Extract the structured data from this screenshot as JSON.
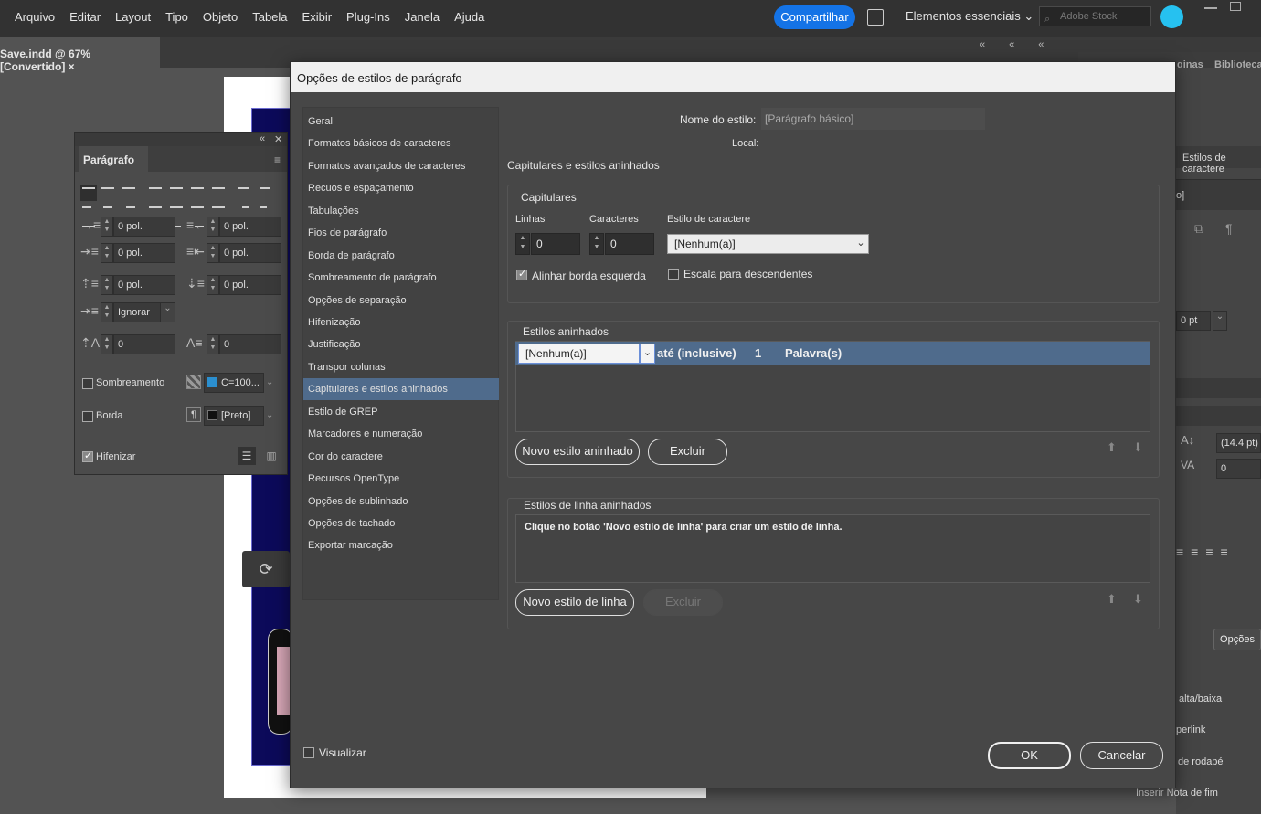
{
  "menubar": {
    "items": [
      "Arquivo",
      "Editar",
      "Layout",
      "Tipo",
      "Objeto",
      "Tabela",
      "Exibir",
      "Plug-Ins",
      "Janela",
      "Ajuda"
    ],
    "share": "Compartilhar",
    "workspace": "Elementos essenciais",
    "stock_placeholder": "Adobe Stock"
  },
  "document": {
    "tab_title": "Save.indd @ 67% [Convertido]",
    "close": "×"
  },
  "paragraph_panel": {
    "title": "Parágrafo",
    "indent_left": "0 pol.",
    "indent_right": "0 pol.",
    "first_line": "0 pol.",
    "last_line": "0 pol.",
    "space_before": "0 pol.",
    "space_after": "0 pol.",
    "grid_align": "Ignorar",
    "dropcap_lines": "0",
    "dropcap_chars": "0",
    "shading_label": "Sombreamento",
    "shading_value": "C=100...",
    "border_label": "Borda",
    "border_value": "[Preto]",
    "hyphenate_label": "Hifenizar",
    "shading_checked": false,
    "border_checked": false,
    "hyphenate_checked": true
  },
  "right_panel": {
    "tab1": "ginas",
    "tab2": "Biblioteca",
    "char_styles": "Estilos de caractere",
    "field1": "o]",
    "spacing": "0 pt",
    "leading": "(14.4 pt)",
    "tracking": "0",
    "options_btn": "Opções",
    "item1": "alta/baixa",
    "item2": "perlink",
    "item3": "de rodapé",
    "item4": "Inserir Nota de fim"
  },
  "dialog": {
    "title": "Opções de estilos de parágrafo",
    "categories": [
      "Geral",
      "Formatos básicos de caracteres",
      "Formatos avançados de caracteres",
      "Recuos e espaçamento",
      "Tabulações",
      "Fios de parágrafo",
      "Borda de parágrafo",
      "Sombreamento de parágrafo",
      "Opções de separação",
      "Hifenização",
      "Justificação",
      "Transpor colunas",
      "Capitulares e estilos aninhados",
      "Estilo de GREP",
      "Marcadores e numeração",
      "Cor do caractere",
      "Recursos OpenType",
      "Opções de sublinhado",
      "Opções de tachado",
      "Exportar marcação"
    ],
    "selected_category": "Capitulares e estilos aninhados",
    "style_name_label": "Nome do estilo:",
    "style_name_value": "[Parágrafo básico]",
    "location_label": "Local:",
    "section_title": "Capitulares e estilos aninhados",
    "dropcaps": {
      "legend": "Capitulares",
      "lines_label": "Linhas",
      "lines_value": "0",
      "chars_label": "Caracteres",
      "chars_value": "0",
      "char_style_label": "Estilo de caractere",
      "char_style_value": "[Nenhum(a)]",
      "align_left_label": "Alinhar borda esquerda",
      "align_left_checked": true,
      "scale_desc_label": "Escala para descendentes",
      "scale_desc_checked": false
    },
    "nested": {
      "legend": "Estilos aninhados",
      "row_style": "[Nenhum(a)]",
      "row_through": "até (inclusive)",
      "row_count": "1",
      "row_unit": "Palavra(s)",
      "new_button": "Novo estilo aninhado",
      "delete_button": "Excluir"
    },
    "line_styles": {
      "legend": "Estilos de linha aninhados",
      "hint": "Clique no botão 'Novo estilo de linha' para criar um estilo de linha.",
      "new_button": "Novo estilo de linha",
      "delete_button": "Excluir"
    },
    "preview_label": "Visualizar",
    "preview_checked": false,
    "ok": "OK",
    "cancel": "Cancelar"
  },
  "colors": {
    "accent": "#1473e6",
    "selected_row": "#4f6b8c",
    "page_blue": "#0c0a5a"
  }
}
